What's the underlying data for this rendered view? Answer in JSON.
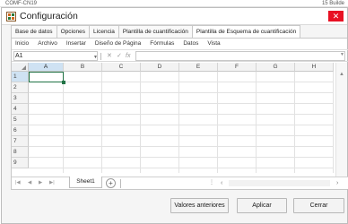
{
  "background": {
    "left_text": "COMF-CN19",
    "right_text": "15 Builde"
  },
  "dialog": {
    "title": "Configuración",
    "close": "✕"
  },
  "tabs": [
    {
      "label": "Base de datos"
    },
    {
      "label": "Opciones"
    },
    {
      "label": "Licencia"
    },
    {
      "label": "Plantilla de cuantificación"
    },
    {
      "label": "Plantilla de Esquema de cuantificación"
    }
  ],
  "menu": [
    {
      "label": "Inicio"
    },
    {
      "label": "Archivo"
    },
    {
      "label": "Insertar"
    },
    {
      "label": "Diseño de Página"
    },
    {
      "label": "Fórmulas"
    },
    {
      "label": "Datos"
    },
    {
      "label": "Vista"
    }
  ],
  "formula_bar": {
    "name_box": "A1",
    "cancel": "✕",
    "ok": "✓",
    "function": "fx",
    "value": ""
  },
  "grid": {
    "columns": [
      "A",
      "B",
      "C",
      "D",
      "E",
      "F",
      "G",
      "H"
    ],
    "rows": [
      "1",
      "2",
      "3",
      "4",
      "5",
      "6",
      "7",
      "8",
      "9"
    ],
    "selected_column": "A",
    "selected_row": "1"
  },
  "sheets": {
    "tabs": [
      "Sheet1"
    ],
    "add_label": "+"
  },
  "buttons": {
    "previous_values": "Valores anteriores",
    "apply": "Aplicar",
    "close": "Cerrar"
  },
  "colors": {
    "accent": "#217346",
    "selection": "#cfe2f3",
    "close_red": "#e81123"
  }
}
